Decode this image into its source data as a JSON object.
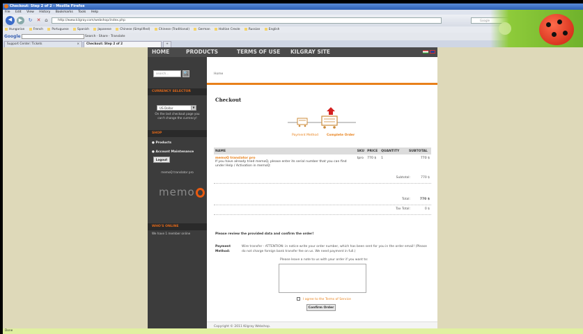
{
  "browser": {
    "window_title": "Checkout: Step 2 of 2 - Mozilla Firefox",
    "menu": [
      "File",
      "Edit",
      "View",
      "History",
      "Bookmarks",
      "Tools",
      "Help"
    ],
    "url": "http://www.kilgray.com/webshop/index.php",
    "search_placeholder": "Google",
    "bookmarks": [
      "Hungarian",
      "French",
      "Portuguese",
      "Spanish",
      "Japanese",
      "Chinese (Simplified)",
      "Chinese (Traditional)",
      "German",
      "Haitian Creole",
      "Russian",
      "English"
    ],
    "google_logo": "Google",
    "google_tools": "Search · Share · Translate",
    "tabs": [
      "Support Center: Tickets",
      "Checkout: Step 2 of 2"
    ],
    "new_tab": "+",
    "status": "Done"
  },
  "site": {
    "nav": [
      "HOME",
      "PRODUCTS",
      "TERMS OF USE",
      "KILGRAY SITE"
    ],
    "search_placeholder": "search...",
    "currency_header": "CURRENCY SELECTOR",
    "currency_value": "US Dollar",
    "currency_note": [
      "On the last checkout page you",
      "can't change the currency!"
    ],
    "shop_header": "SHOP",
    "shop_links": [
      "Products",
      "Account Maintenance"
    ],
    "logout": "Logout",
    "cart_item": "memoQ translator pro",
    "logo_text": "memo",
    "whos_online_header": "WHO'S ONLINE",
    "whos_online_text": "We have 1 member online"
  },
  "checkout": {
    "breadcrumb": "Home",
    "title": "Checkout",
    "step1": "Payment Method",
    "step2": "Complete Order",
    "columns": [
      "NAME",
      "SKU",
      "PRICE",
      "QUANTITY",
      "SUBTOTAL"
    ],
    "item": {
      "name": "memoQ translator pro",
      "desc": "If you have already tried memoQ, please enter its serial number that you can find under Help / Activation in memoQ:",
      "sku": "tpro",
      "price": "770 $",
      "quantity": "1",
      "subtotal": "770 $"
    },
    "subtotal_label": "Subtotal:",
    "subtotal_value": "770 $",
    "total_label": "Total:",
    "total_value": "770 $",
    "tax_label": "Tax Total:",
    "tax_value": "0 $",
    "review_text": "Please review the provided data and confirm the order!",
    "payment_label_1": "Payment",
    "payment_label_2": "Method:",
    "payment_text": "Wire transfer - ATTENTION: in notice write your order number, which has been sent for you in the order email! (Please do not charge foreign bank transfer fee on us. We need payment in full.)",
    "note_label": "Please leave a note to us with your order if you want to:",
    "agree_text": "I agree to the Terms of Service",
    "confirm_button": "Confirm Order",
    "footer": "Copyright © 2011 Kilgray Webshop."
  },
  "colors": {
    "accent": "#e8801a",
    "sidebar": "#3c3c3c",
    "background": "#ded9b9"
  }
}
